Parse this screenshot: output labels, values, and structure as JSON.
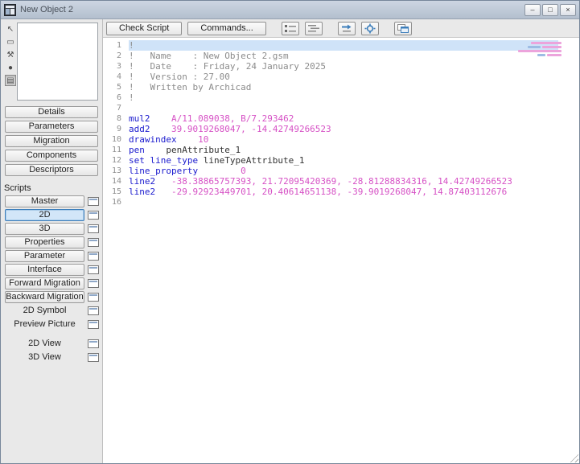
{
  "window": {
    "title": "New Object 2",
    "controls": {
      "minimize": "–",
      "maximize": "□",
      "close": "×"
    }
  },
  "colors": {
    "keyword": "#1a1ace",
    "value": "#d651c5",
    "comment": "#8b8b8b",
    "selection": "#cfe3f8",
    "accent": "#3d7ebb"
  },
  "sidebar": {
    "panel_buttons": [
      "Details",
      "Parameters",
      "Migration",
      "Components",
      "Descriptors"
    ],
    "scripts_label": "Scripts",
    "tool_icons": [
      {
        "name": "pointer-icon",
        "glyph": "↖",
        "pressed": false
      },
      {
        "name": "rectangle-icon",
        "glyph": "▭",
        "pressed": false
      },
      {
        "name": "hammer-icon",
        "glyph": "⚒",
        "pressed": false
      },
      {
        "name": "sphere-icon",
        "glyph": "●",
        "pressed": false
      },
      {
        "name": "film-icon",
        "glyph": "▤",
        "pressed": true
      }
    ],
    "scripts": [
      {
        "label": "Master",
        "selected": false,
        "flat": false
      },
      {
        "label": "2D",
        "selected": true,
        "flat": false
      },
      {
        "label": "3D",
        "selected": false,
        "flat": false
      },
      {
        "label": "Properties",
        "selected": false,
        "flat": false
      },
      {
        "label": "Parameter",
        "selected": false,
        "flat": false
      },
      {
        "label": "Interface",
        "selected": false,
        "flat": false
      },
      {
        "label": "Forward Migration",
        "selected": false,
        "flat": false
      },
      {
        "label": "Backward Migration",
        "selected": false,
        "flat": false
      },
      {
        "label": "2D Symbol",
        "selected": false,
        "flat": true
      },
      {
        "label": "Preview Picture",
        "selected": false,
        "flat": true
      }
    ],
    "views": [
      "2D View",
      "3D View"
    ]
  },
  "toolbar": {
    "check_script": "Check Script",
    "commands": "Commands...",
    "icons": [
      "numbered-list-icon",
      "indent-list-icon",
      "swap-values-icon",
      "settings-icon",
      "editor-windows-icon"
    ]
  },
  "editor": {
    "lines": [
      {
        "n": "1",
        "sel": true,
        "segs": [
          [
            "!",
            "comment"
          ]
        ]
      },
      {
        "n": "2",
        "sel": false,
        "segs": [
          [
            "!   Name    : New Object 2.gsm",
            "comment"
          ]
        ]
      },
      {
        "n": "3",
        "sel": false,
        "segs": [
          [
            "!   Date    : Friday, 24 January 2025",
            "comment"
          ]
        ]
      },
      {
        "n": "4",
        "sel": false,
        "segs": [
          [
            "!   Version : 27.00",
            "comment"
          ]
        ]
      },
      {
        "n": "5",
        "sel": false,
        "segs": [
          [
            "!   Written by Archicad",
            "comment"
          ]
        ]
      },
      {
        "n": "6",
        "sel": false,
        "segs": [
          [
            "!",
            "comment"
          ]
        ]
      },
      {
        "n": "7",
        "sel": false,
        "segs": []
      },
      {
        "n": "8",
        "sel": false,
        "segs": [
          [
            "mul2",
            "kw"
          ],
          [
            "    ",
            "plain"
          ],
          [
            "A/11.089038, B/7.293462",
            "val"
          ]
        ]
      },
      {
        "n": "9",
        "sel": false,
        "segs": [
          [
            "add2",
            "kw"
          ],
          [
            "    ",
            "plain"
          ],
          [
            "39.9019268047, -14.42749266523",
            "val"
          ]
        ]
      },
      {
        "n": "10",
        "sel": false,
        "segs": [
          [
            "drawindex",
            "kw"
          ],
          [
            "    ",
            "plain"
          ],
          [
            "10",
            "val"
          ]
        ]
      },
      {
        "n": "11",
        "sel": false,
        "segs": [
          [
            "pen",
            "kw"
          ],
          [
            "    ",
            "plain"
          ],
          [
            "penAttribute_1",
            "plain"
          ]
        ]
      },
      {
        "n": "12",
        "sel": false,
        "segs": [
          [
            "set line_type",
            "kw"
          ],
          [
            " ",
            "plain"
          ],
          [
            "lineTypeAttribute_1",
            "plain"
          ]
        ]
      },
      {
        "n": "13",
        "sel": false,
        "segs": [
          [
            "line_property",
            "kw"
          ],
          [
            "        ",
            "plain"
          ],
          [
            "0",
            "val"
          ]
        ]
      },
      {
        "n": "14",
        "sel": false,
        "segs": [
          [
            "line2",
            "kw"
          ],
          [
            "   ",
            "plain"
          ],
          [
            "-38.38865757393, 21.72095420369, -28.81288834316, 14.42749266523",
            "val"
          ]
        ]
      },
      {
        "n": "15",
        "sel": false,
        "segs": [
          [
            "line2",
            "kw"
          ],
          [
            "   ",
            "plain"
          ],
          [
            "-29.92923449701, 20.40614651138, -39.9019268047, 14.87403112676",
            "val"
          ]
        ]
      },
      {
        "n": "16",
        "sel": false,
        "segs": []
      }
    ]
  }
}
